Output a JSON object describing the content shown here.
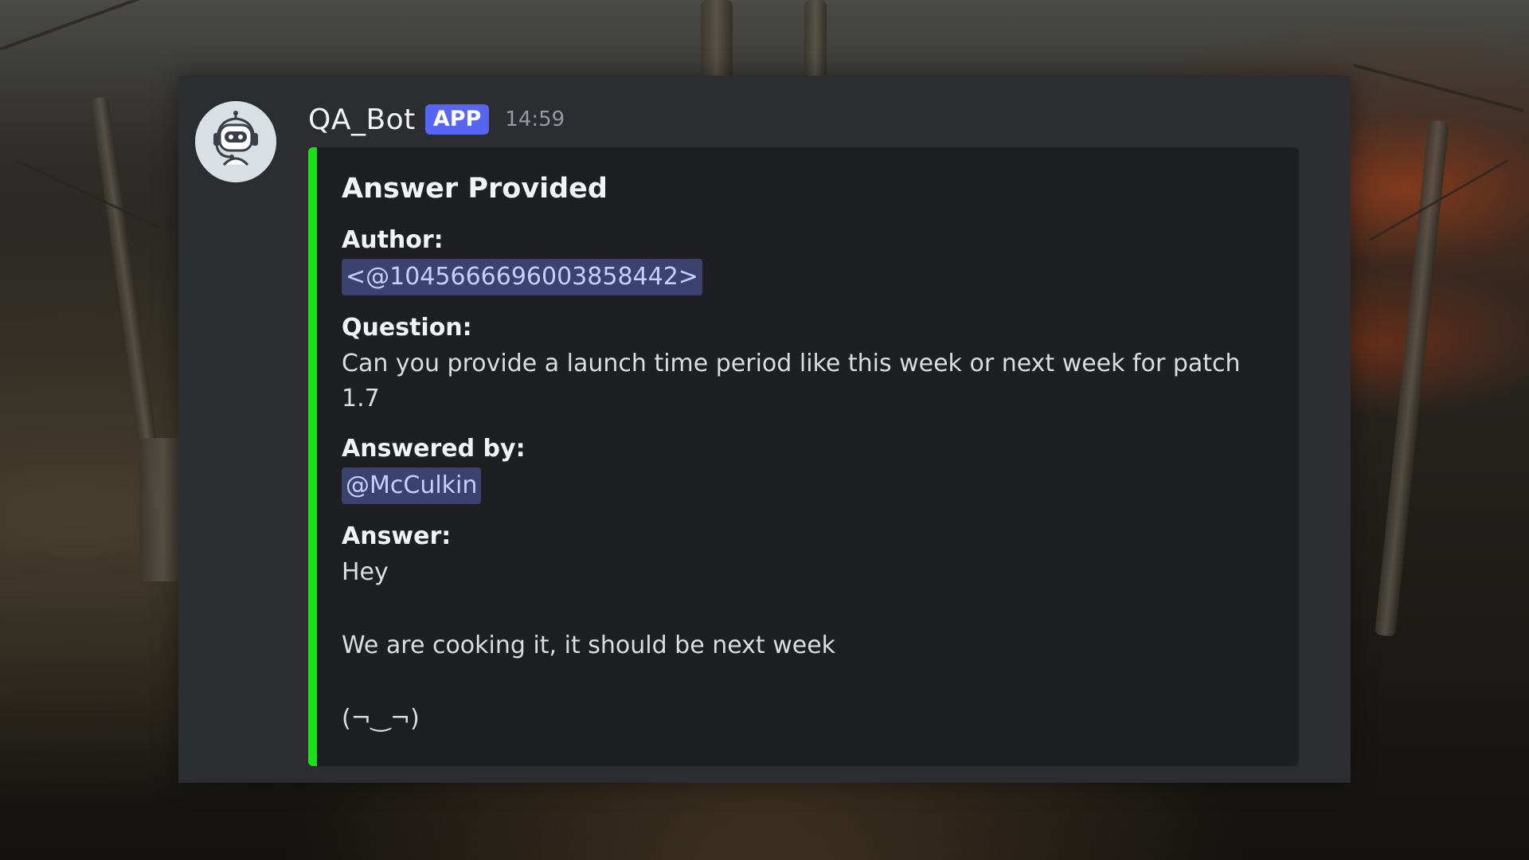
{
  "message": {
    "username": "QA_Bot",
    "badge": "APP",
    "timestamp": "14:59",
    "avatar_icon": "robot-headset-icon"
  },
  "embed": {
    "accent_color": "#14e414",
    "title": "Answer Provided",
    "fields": {
      "author": {
        "name": "Author:",
        "value": "<@1045666696003858442>"
      },
      "question": {
        "name": "Question:",
        "value": "Can you provide a launch time period like this week or next week for patch 1.7"
      },
      "answered_by": {
        "name": "Answered by:",
        "value": "@McCulkin"
      },
      "answer": {
        "name": "Answer:",
        "lines": [
          "Hey",
          "We are cooking it, it should be next week",
          "(¬‿¬)"
        ]
      }
    }
  },
  "colors": {
    "panel_bg": "#2b2d31",
    "embed_bg": "#1e1f22",
    "badge_bg": "#5865f2",
    "mention_bg": "#3c4270",
    "mention_text": "#c9cdfb"
  }
}
